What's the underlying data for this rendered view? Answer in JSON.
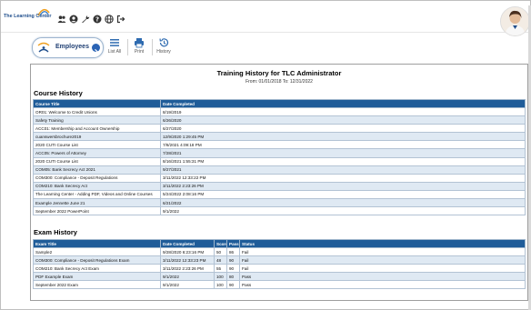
{
  "app": {
    "logo_name": "The Learning Center",
    "logo_tagline": "",
    "top_icons": [
      "users-icon",
      "account-icon",
      "wrench-icon",
      "help-icon",
      "globe-icon",
      "logout-icon"
    ]
  },
  "toolbar": {
    "employees_label": "Employees",
    "list_all_label": "List All",
    "print_label": "Print",
    "history_label": "History"
  },
  "report": {
    "title": "Training History for TLC Administrator",
    "date_range": "From: 01/01/2018   To: 12/31/2022",
    "course_section_title": "Course History",
    "course_columns": [
      "Course Title",
      "Date Completed"
    ],
    "courses": [
      [
        "OR01: Welcome to Credit Unions",
        "8/19/2019"
      ],
      [
        "Safety Training",
        "6/26/2020"
      ],
      [
        "ACC01: Membership and Account Ownership",
        "6/27/2020"
      ],
      [
        "cuanswersbrochure2019",
        "12/9/2020 1:29:45 PM"
      ],
      [
        "2020 CUTI Course List",
        "7/8/2021 4:09:18 PM"
      ],
      [
        "ACC05: Powers of Attorney",
        "7/28/2021"
      ],
      [
        "2020 CUTI Course List",
        "8/16/2021 1:55:31 PM"
      ],
      [
        "COM05: Bank Secrecy Act 2021",
        "9/27/2021"
      ],
      [
        "COM300: Compliance - Deposit Regulations",
        "3/11/2022 12:33:22 PM"
      ],
      [
        "COM210: Bank Secrecy Act",
        "3/11/2022 2:23:26 PM"
      ],
      [
        "The Learning Center - Adding PDF, Videos and Online Courses",
        "5/24/2022 2:08:16 PM"
      ],
      [
        "Example Jennette June 21",
        "6/21/2022"
      ],
      [
        "September 2022 PowerPoint",
        "9/1/2022"
      ]
    ],
    "exam_section_title": "Exam History",
    "exam_columns": [
      "Exam Title",
      "Date Completed",
      "Score",
      "Pass %",
      "Status"
    ],
    "exams": [
      [
        "Sample2",
        "9/28/2020 6:23:16 PM",
        "50",
        "86",
        "Fail"
      ],
      [
        "COM300: Compliance - Deposit Regulations Exam",
        "3/11/2022 12:33:23 PM",
        "48",
        "90",
        "Fail"
      ],
      [
        "COM210: Bank Secrecy Act Exam",
        "3/11/2022 2:23:26 PM",
        "55",
        "90",
        "Fail"
      ],
      [
        "PDF Example Exam",
        "9/1/2022",
        "100",
        "80",
        "Pass"
      ],
      [
        "September 2022 Exam",
        "9/1/2022",
        "100",
        "90",
        "Pass"
      ]
    ]
  },
  "colors": {
    "header_blue": "#1f5c99",
    "row_alt": "#dfe9f3",
    "brand_navy": "#1f3f73"
  }
}
